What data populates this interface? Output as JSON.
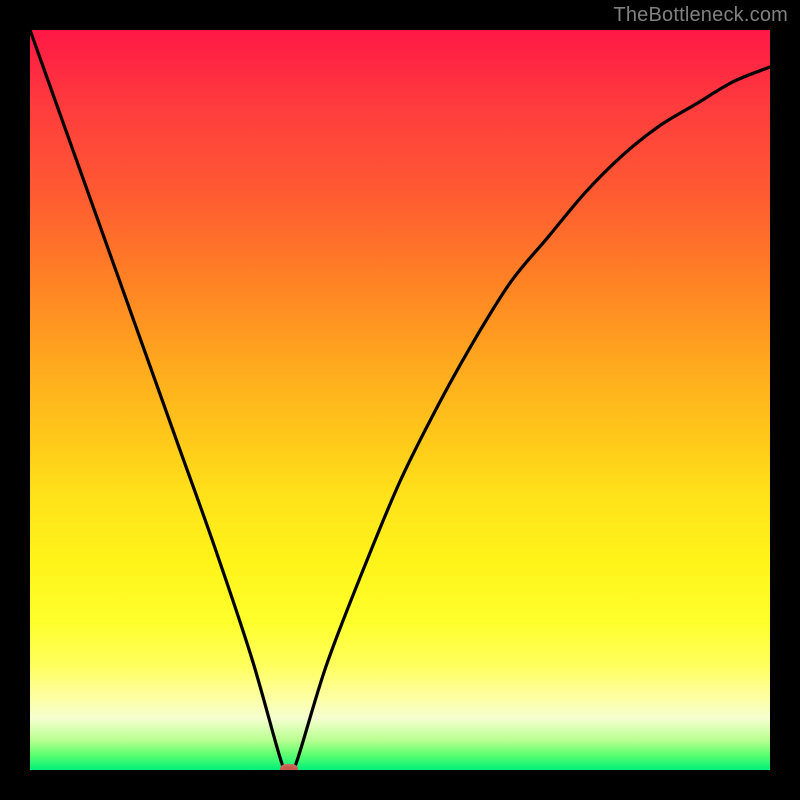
{
  "watermark": {
    "text": "TheBottleneck.com"
  },
  "chart_data": {
    "type": "line",
    "title": "",
    "xlabel": "",
    "ylabel": "",
    "xlim": [
      0,
      100
    ],
    "ylim": [
      0,
      100
    ],
    "grid": false,
    "legend": false,
    "background_gradient": {
      "top_color": "#ff1845",
      "mid_color": "#ffe21a",
      "bottom_color": "#00f07a",
      "meaning": "bottleneck severity (red=high, green=none)"
    },
    "series": [
      {
        "name": "bottleneck-curve",
        "x": [
          0,
          5,
          10,
          15,
          20,
          25,
          30,
          34,
          35,
          36,
          40,
          45,
          50,
          55,
          60,
          65,
          70,
          75,
          80,
          85,
          90,
          95,
          100
        ],
        "values": [
          100,
          86,
          72,
          58,
          44,
          30,
          15,
          1,
          0,
          1,
          14,
          27,
          39,
          49,
          58,
          66,
          72,
          78,
          83,
          87,
          90,
          93,
          95
        ]
      }
    ],
    "marker": {
      "x": 35,
      "y": 0,
      "meaning": "current-configuration"
    }
  }
}
